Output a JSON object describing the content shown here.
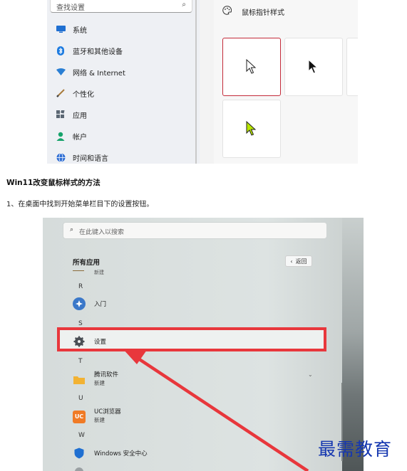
{
  "settings_shot": {
    "search_placeholder": "查找设置",
    "nav": [
      {
        "label": "系统",
        "icon": "system-icon"
      },
      {
        "label": "蓝牙和其他设备",
        "icon": "bluetooth-icon"
      },
      {
        "label": "网络 & Internet",
        "icon": "network-icon"
      },
      {
        "label": "个性化",
        "icon": "brush-icon"
      },
      {
        "label": "应用",
        "icon": "apps-icon"
      },
      {
        "label": "帐户",
        "icon": "account-icon"
      },
      {
        "label": "时间和语言",
        "icon": "globe-icon"
      }
    ],
    "section_title": "鼠标指针样式",
    "pointer_styles": [
      "white",
      "black",
      "inverted",
      "custom-lime"
    ],
    "selected_color": "#c42b3a",
    "custom_color": "#b8e600"
  },
  "article": {
    "heading": "Win11改变鼠标样式的方法",
    "step1": "1、在桌面中找到开始菜单栏目下的设置按钮。"
  },
  "start_menu_shot": {
    "search_placeholder": "在此键入以搜索",
    "all_apps": "所有应用",
    "back_label": "返回",
    "partial_item": "新建",
    "letters": [
      "R",
      "S",
      "T",
      "U",
      "W"
    ],
    "apps": {
      "intro": "入门",
      "settings": "设置",
      "tencent_name": "腾讯软件",
      "tencent_sub": "新建",
      "uc_name": "UC浏览器",
      "uc_sub": "新建",
      "security": "Windows 安全中心"
    },
    "highlight_color": "#e8373c"
  },
  "watermark": "最需教育"
}
